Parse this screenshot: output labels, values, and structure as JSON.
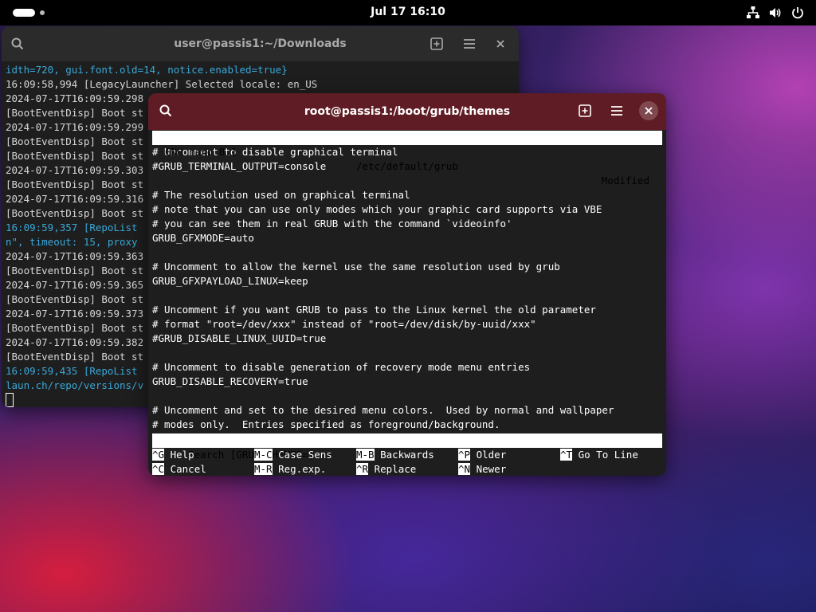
{
  "topbar": {
    "clock": "Jul 17  16:10",
    "tray_icons": [
      "network-icon",
      "volume-icon",
      "power-icon"
    ]
  },
  "window_back": {
    "title": "user@passis1:~/Downloads",
    "lines": [
      {
        "text": "idth=720, gui.font.old=14, notice.enabled=true}",
        "color": "blue"
      },
      {
        "text": "16:09:58,994 [LegacyLauncher] Selected locale: en_US",
        "color": "normal"
      },
      {
        "text": "2024-07-17T16:09:59.298",
        "color": "normal"
      },
      {
        "text": "[BootEventDisp] Boot st",
        "color": "normal"
      },
      {
        "text": "2024-07-17T16:09:59.299",
        "color": "normal"
      },
      {
        "text": "[BootEventDisp] Boot st",
        "color": "normal"
      },
      {
        "text": "[BootEventDisp] Boot st",
        "color": "normal"
      },
      {
        "text": "2024-07-17T16:09:59.303",
        "color": "normal"
      },
      {
        "text": "[BootEventDisp] Boot st",
        "color": "normal"
      },
      {
        "text": "2024-07-17T16:09:59.316",
        "color": "normal"
      },
      {
        "text": "[BootEventDisp] Boot st",
        "color": "normal"
      },
      {
        "text": "16:09:59,357 [RepoList",
        "color": "blue"
      },
      {
        "text": "n\", timeout: 15, proxy",
        "color": "blue"
      },
      {
        "text": "2024-07-17T16:09:59.363",
        "color": "normal"
      },
      {
        "text": "[BootEventDisp] Boot st",
        "color": "normal"
      },
      {
        "text": "2024-07-17T16:09:59.365",
        "color": "normal"
      },
      {
        "text": "[BootEventDisp] Boot st",
        "color": "normal"
      },
      {
        "text": "2024-07-17T16:09:59.373",
        "color": "normal"
      },
      {
        "text": "[BootEventDisp] Boot st",
        "color": "normal"
      },
      {
        "text": "2024-07-17T16:09:59.382",
        "color": "normal"
      },
      {
        "text": "[BootEventDisp] Boot st",
        "color": "normal"
      },
      {
        "text": "16:09:59,435 [RepoList",
        "color": "blue"
      },
      {
        "text": "laun.ch/repo/versions/v",
        "color": "blue"
      }
    ]
  },
  "window_front": {
    "title": "root@passis1:/boot/grub/themes",
    "nano": {
      "version": "GNU nano 8.1",
      "file": "/etc/default/grub",
      "status": "Modified",
      "lines": [
        "# Uncomment to disable graphical terminal",
        "#GRUB_TERMINAL_OUTPUT=console",
        "",
        "# The resolution used on graphical terminal",
        "# note that you can use only modes which your graphic card supports via VBE",
        "# you can see them in real GRUB with the command `videoinfo'",
        "GRUB_GFXMODE=auto",
        "",
        "# Uncomment to allow the kernel use the same resolution used by grub",
        "GRUB_GFXPAYLOAD_LINUX=keep",
        "",
        "# Uncomment if you want GRUB to pass to the Linux kernel the old parameter",
        "# format \"root=/dev/xxx\" instead of \"root=/dev/disk/by-uuid/xxx\"",
        "#GRUB_DISABLE_LINUX_UUID=true",
        "",
        "# Uncomment to disable generation of recovery mode menu entries",
        "GRUB_DISABLE_RECOVERY=true",
        "",
        "# Uncomment and set to the desired menu colors.  Used by normal and wallpaper",
        "# modes only.  Entries specified as foreground/background."
      ],
      "search_prompt": "Search [GRUB_THEMES=]: =",
      "shortcuts_row1": [
        {
          "key": "^G",
          "label": "Help"
        },
        {
          "key": "M-C",
          "label": "Case Sens"
        },
        {
          "key": "M-B",
          "label": "Backwards"
        },
        {
          "key": "^P",
          "label": "Older"
        },
        {
          "key": "^T",
          "label": "Go To Line"
        }
      ],
      "shortcuts_row2": [
        {
          "key": "^C",
          "label": "Cancel"
        },
        {
          "key": "M-R",
          "label": "Reg.exp."
        },
        {
          "key": "^R",
          "label": "Replace"
        },
        {
          "key": "^N",
          "label": "Newer"
        }
      ]
    }
  }
}
